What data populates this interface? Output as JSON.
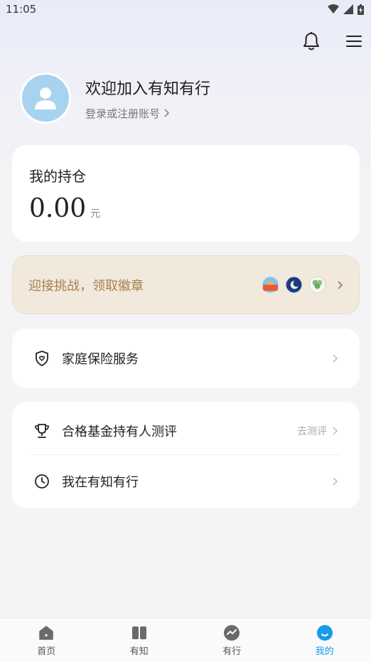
{
  "status_bar": {
    "time": "11:05"
  },
  "profile": {
    "welcome_text": "欢迎加入有知有行",
    "login_text": "登录或注册账号"
  },
  "holdings": {
    "title": "我的持仓",
    "amount": "0.00",
    "unit": "元"
  },
  "challenge": {
    "text": "迎接挑战，领取徽章",
    "badges": [
      "sunrise-badge-icon",
      "moon-badge-icon",
      "clover-badge-icon"
    ]
  },
  "menu": {
    "insurance_label": "家庭保险服务",
    "fund_eval_label": "合格基金持有人测评",
    "fund_eval_action": "去测评",
    "history_label": "我在有知有行"
  },
  "tabs": [
    {
      "label": "首页",
      "icon": "home-icon",
      "active": false
    },
    {
      "label": "有知",
      "icon": "book-icon",
      "active": false
    },
    {
      "label": "有行",
      "icon": "trend-icon",
      "active": false
    },
    {
      "label": "我的",
      "icon": "smile-icon",
      "active": true
    }
  ],
  "colors": {
    "accent": "#1a9ae8",
    "challenge_bg": "#f2e9dd",
    "challenge_text": "#a77f4e",
    "avatar_bg": "#a7d3ef"
  }
}
